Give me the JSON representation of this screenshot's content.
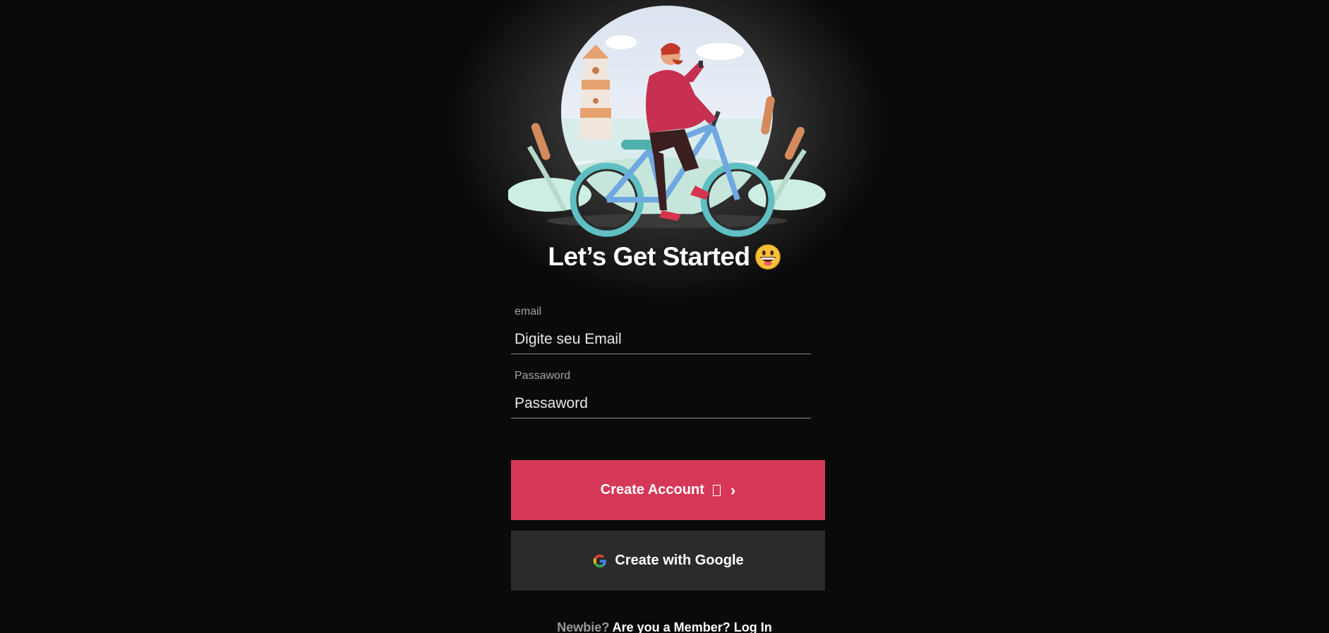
{
  "hero": {
    "illustration": "man-riding-bicycle-illustration"
  },
  "title": {
    "text": "Let’s Get Started",
    "emoji_icon": "grinning-face-emoji"
  },
  "email": {
    "label": "email",
    "placeholder": "Digite seu Email",
    "value": ""
  },
  "password": {
    "label": "Passaword",
    "placeholder": "Passaword",
    "value": ""
  },
  "create_button": {
    "label": "Create Account",
    "icon": "chevron-right-icon",
    "color": "#d63756"
  },
  "google_button": {
    "label": "Create with Google",
    "icon": "google-icon",
    "color": "#2b2b2b"
  },
  "footer": {
    "prefix": "Newbie?",
    "link": "Are you a Member? Log In"
  },
  "colors": {
    "background": "#0a0a0a",
    "accent": "#d63756"
  }
}
